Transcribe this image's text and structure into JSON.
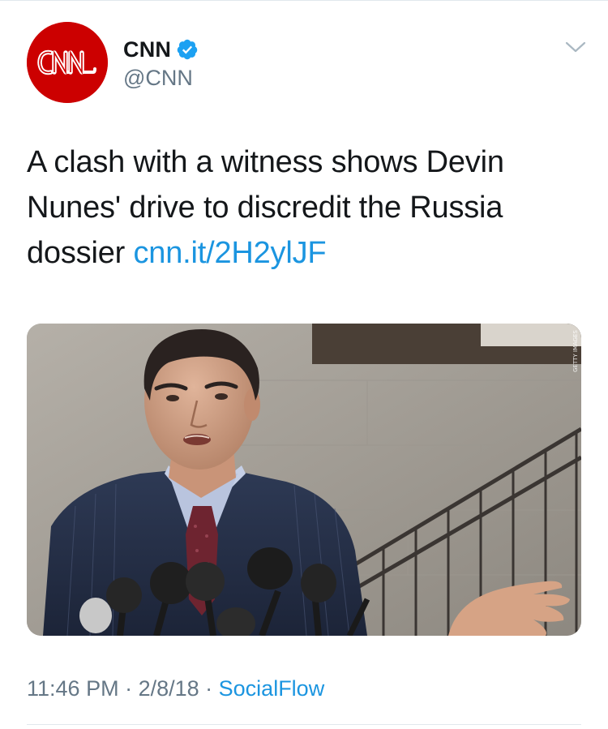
{
  "account": {
    "display_name": "CNN",
    "handle": "@CNN",
    "verified": true,
    "avatar_logo_text": "CNN",
    "avatar_color": "#cc0000"
  },
  "tweet": {
    "text": "A clash with a witness shows Devin Nunes' drive to discredit the Russia dossier ",
    "link": "cnn.it/2H2ylJF"
  },
  "media": {
    "watermark": "GETTY IMAGES"
  },
  "meta": {
    "time": "11:46 PM",
    "separator_1": " · ",
    "date": "2/8/18",
    "separator_2": " · ",
    "source": "SocialFlow"
  },
  "colors": {
    "link": "#1b95e0",
    "secondary_text": "#657786",
    "primary_text": "#14171a",
    "divider": "#e1e8ed",
    "verified_badge": "#1da1f2"
  },
  "icons": {
    "verified": "verified-badge-icon",
    "menu": "chevron-down-icon"
  }
}
